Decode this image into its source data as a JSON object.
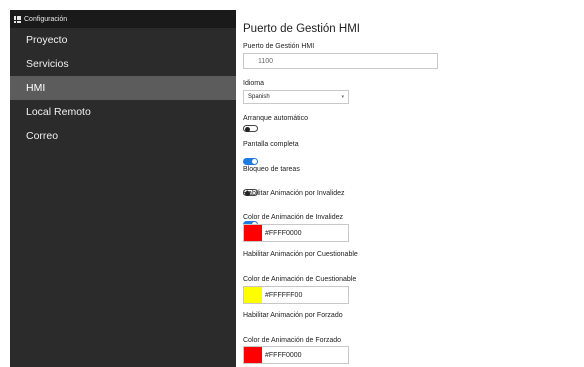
{
  "sidebar": {
    "header": "Configuración",
    "items": [
      {
        "label": "Proyecto",
        "active": false
      },
      {
        "label": "Servicios",
        "active": false
      },
      {
        "label": "HMI",
        "active": true
      },
      {
        "label": "Local Remoto",
        "active": false
      },
      {
        "label": "Correo",
        "active": false
      }
    ]
  },
  "main": {
    "title": "Puerto de Gestión HMI",
    "port": {
      "label": "Puerto de Gestión HMI",
      "placeholder": "1100"
    },
    "language": {
      "label": "Idioma",
      "value": "Spanish"
    },
    "autostart": {
      "label": "Arranque automático",
      "on": false
    },
    "fullscreen": {
      "label": "Pantalla completa",
      "on": true
    },
    "tasklock": {
      "label": "Bloqueo de tareas",
      "on": false
    },
    "invalid_anim": {
      "label": "Habilitar Animación por Invalidez",
      "on": true
    },
    "invalid_color": {
      "label": "Color de Animación de Invalidez",
      "value": "#FFFF0000",
      "swatch": "#ff0000"
    },
    "questionable_anim": {
      "label": "Habilitar Animación por Cuestionable",
      "on": true
    },
    "questionable_color": {
      "label": "Color de Animación de Cuestionable",
      "value": "#FFFFFF00",
      "swatch": "#ffff00"
    },
    "forced_anim": {
      "label": "Habilitar Animación por Forzado",
      "on": true
    },
    "forced_color": {
      "label": "Color de Animación de Forzado",
      "value": "#FFFF0000",
      "swatch": "#ff0000"
    }
  }
}
